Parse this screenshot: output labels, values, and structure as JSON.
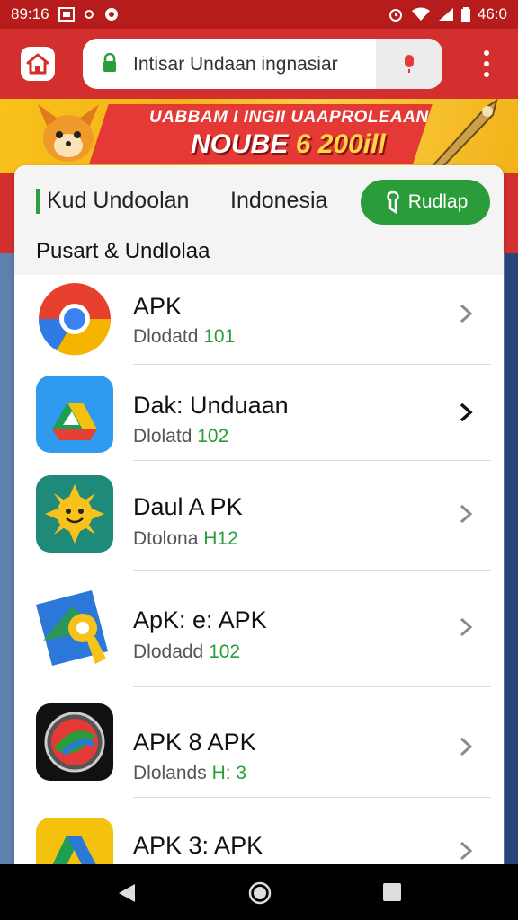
{
  "status_bar": {
    "time": "89:16",
    "clock_right": "46:0",
    "icons": [
      "photo-icon",
      "ring-icon",
      "alert-icon",
      "alarm-icon",
      "wifi-icon",
      "signal-icon",
      "battery-icon"
    ]
  },
  "browser": {
    "url_text": "Intisar Undaan ingnasiar",
    "home_icon": "home-icon",
    "secure_icon": "lock-icon",
    "voice_icon": "mic-icon",
    "menu_icon": "more-vert-icon"
  },
  "banner": {
    "line1": "UABBAM I INGII UAAPROLEAAN",
    "line2_text": "NOUBE ",
    "line2_highlight": "6 200ill"
  },
  "header": {
    "tab_primary": "Kud Undoolan",
    "tab_secondary": "Indonesia",
    "cta_label": "Rudlap",
    "section_title": "Pusart & Undlolaa"
  },
  "apps": [
    {
      "title": "APK",
      "sub_label": "Dlodatd",
      "sub_version": "101",
      "icon": "chrome-icon"
    },
    {
      "title": "Dak: Unduaan",
      "sub_label": "Dlolatd",
      "sub_version": "102",
      "icon": "drive-icon"
    },
    {
      "title": "Daul A PK",
      "sub_label": "Dtolona",
      "sub_version": "H12",
      "icon": "sun-icon"
    },
    {
      "title": "ApK: e: APK",
      "sub_label": "Dlodadd",
      "sub_version": "102",
      "icon": "maps-icon"
    },
    {
      "title": "APK 8 APK",
      "sub_label": "Dlolands",
      "sub_version": "H: 3",
      "icon": "lens-icon"
    },
    {
      "title": "APK 3: APK",
      "sub_label": "",
      "sub_version": "",
      "icon": "drive-icon"
    }
  ],
  "colors": {
    "brand_red": "#d32f2f",
    "accent_green": "#2a9d3a",
    "banner_yellow": "#f7c21a"
  },
  "nav": {
    "back_icon": "back-icon",
    "home_icon": "home-circle-icon",
    "recents_icon": "recents-icon"
  }
}
